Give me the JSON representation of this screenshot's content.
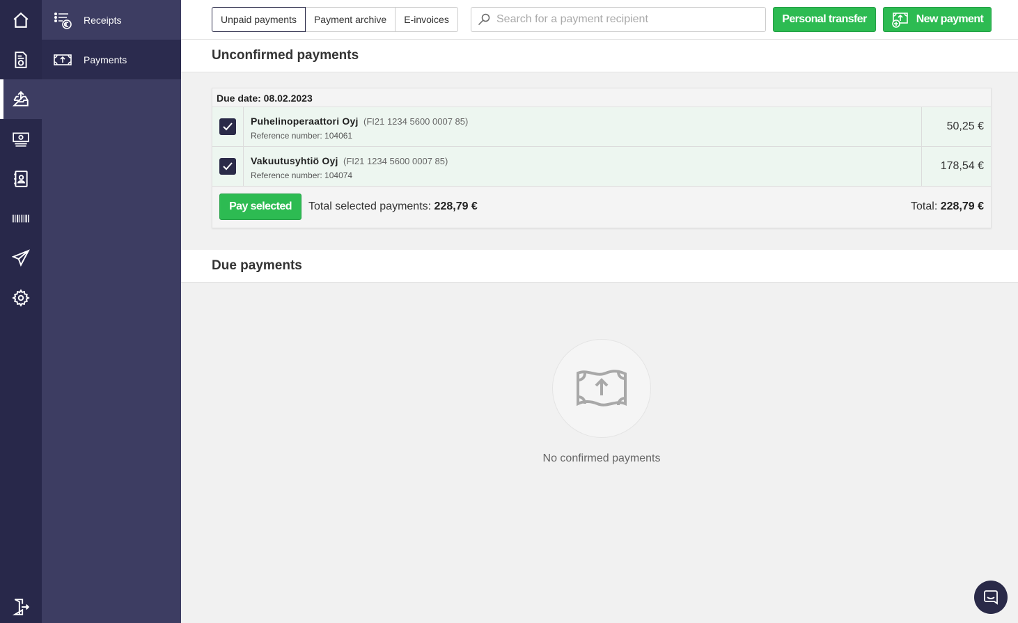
{
  "rail": {
    "items": [
      {
        "icon": "home-icon"
      },
      {
        "icon": "receipt-euro-icon"
      },
      {
        "icon": "inbox-upload-icon",
        "active": true
      },
      {
        "icon": "banknote-icon"
      },
      {
        "icon": "contacts-book-icon"
      },
      {
        "icon": "barcode-icon"
      },
      {
        "icon": "paper-plane-icon"
      },
      {
        "icon": "gear-icon"
      }
    ],
    "logout_icon": "logout-door-icon"
  },
  "subnav": {
    "items": [
      {
        "label": "Receipts",
        "icon": "receipts-list-icon"
      },
      {
        "label": "Payments",
        "icon": "money-upload-icon",
        "active": true
      }
    ]
  },
  "header": {
    "tabs": [
      {
        "label": "Unpaid payments",
        "active": true
      },
      {
        "label": "Payment archive"
      },
      {
        "label": "E-invoices"
      }
    ],
    "search_placeholder": "Search for a payment recipient",
    "personal_transfer_label": "Personal transfer",
    "new_payment_label": "New payment"
  },
  "unconfirmed": {
    "title": "Unconfirmed payments",
    "due_date_label": "Due date: 08.02.2023",
    "rows": [
      {
        "recipient": "Puhelinoperaattori Oyj",
        "iban": "(FI21 1234 5600 0007 85)",
        "reference": "Reference number: 104061",
        "amount": "50,25 €",
        "checked": true
      },
      {
        "recipient": "Vakuutusyhtiö Oyj",
        "iban": "(FI21 1234 5600 0007 85)",
        "reference": "Reference number: 104074",
        "amount": "178,54 €",
        "checked": true
      }
    ],
    "pay_selected_label": "Pay selected",
    "selected_total_label": "Total selected payments:",
    "selected_total_value": "228,79 €",
    "total_label": "Total:",
    "total_value": "228,79 €"
  },
  "due": {
    "title": "Due payments",
    "empty_text": "No confirmed payments"
  },
  "colors": {
    "rail_bg": "#28284a",
    "subnav_bg": "#3d3d62",
    "accent_green": "#2dbb52",
    "row_bg": "#edf6f0",
    "checkbox": "#2a2a48"
  }
}
